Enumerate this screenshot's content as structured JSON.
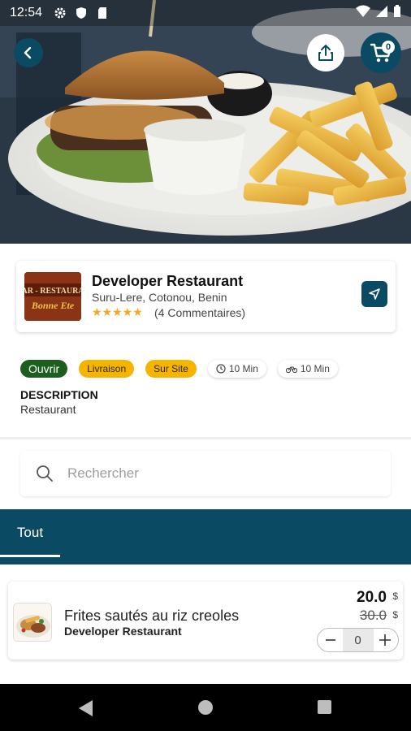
{
  "status_bar": {
    "time": "12:54"
  },
  "header": {
    "cart_count": "0"
  },
  "restaurant": {
    "logo_lines": [
      "AR - RESTAURANT",
      "Bonne Ete"
    ],
    "name": "Developer Restaurant",
    "address": "Suru-Lere, Cotonou, Benin",
    "stars": "★★★★★",
    "rating": 5,
    "reviews": "(4 Commentaires)"
  },
  "tags": {
    "status": "Ouvrir",
    "delivery": "Livraison",
    "on_site": "Sur Site",
    "prep_time": "10 Min",
    "delivery_time": "10 Min"
  },
  "description": {
    "title": "DESCRIPTION",
    "text": "Restaurant"
  },
  "search": {
    "placeholder": "Rechercher"
  },
  "tabs": [
    {
      "label": "Tout",
      "active": true
    }
  ],
  "products": [
    {
      "name": "Frites sautés au riz creoles",
      "restaurant": "Developer Restaurant",
      "price": "20.0",
      "old_price": "30.0",
      "currency": "$",
      "quantity": "0"
    }
  ],
  "colors": {
    "primary": "#0b4a63",
    "open": "#1b5e20",
    "tag_yellow": "#f4b400",
    "star": "#f5a623"
  }
}
